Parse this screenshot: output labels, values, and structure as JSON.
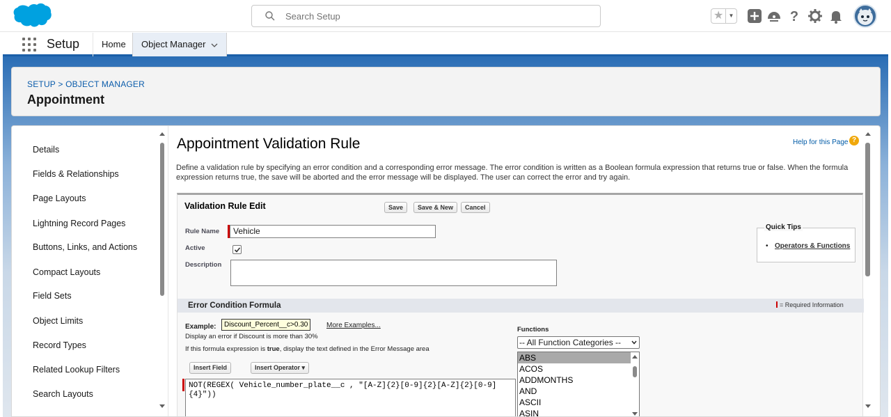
{
  "header": {
    "search_placeholder": "Search Setup",
    "brand_color": "#00A1E0"
  },
  "nav": {
    "app_name": "Setup",
    "tabs": [
      {
        "label": "Home"
      },
      {
        "label": "Object Manager"
      }
    ]
  },
  "page_header": {
    "breadcrumb": "SETUP > OBJECT MANAGER",
    "title": "Appointment"
  },
  "sidebar": {
    "items": [
      {
        "label": "Details"
      },
      {
        "label": "Fields & Relationships"
      },
      {
        "label": "Page Layouts"
      },
      {
        "label": "Lightning Record Pages"
      },
      {
        "label": "Buttons, Links, and Actions"
      },
      {
        "label": "Compact Layouts"
      },
      {
        "label": "Field Sets"
      },
      {
        "label": "Object Limits"
      },
      {
        "label": "Record Types"
      },
      {
        "label": "Related Lookup Filters"
      },
      {
        "label": "Search Layouts"
      }
    ]
  },
  "main": {
    "title": "Appointment Validation Rule",
    "help_link": "Help for this Page",
    "description": "Define a validation rule by specifying an error condition and a corresponding error message. The error condition is written as a Boolean formula expression that returns true or false. When the formula expression returns true, the save will be aborted and the error message will be displayed. The user can correct the error and try again."
  },
  "edit": {
    "section_title": "Validation Rule Edit",
    "save_label": "Save",
    "save_new_label": "Save & New",
    "cancel_label": "Cancel",
    "rule_name_label": "Rule Name",
    "rule_name_value": "Vehicle",
    "active_label": "Active",
    "active_checked": true,
    "description_label": "Description",
    "description_value": ""
  },
  "quick_tips": {
    "title": "Quick Tips",
    "link": "Operators & Functions"
  },
  "formula": {
    "section_title": "Error Condition Formula",
    "required_info": "= Required Information",
    "example_label": "Example:",
    "example_code": "Discount_Percent__c>0.30",
    "more_examples": "More Examples...",
    "hint_line1": "Display an error if Discount is more than 30%",
    "hint_line2_pre": "If this formula expression is ",
    "hint_line2_bold": "true",
    "hint_line2_post": ", display the text defined in the Error Message area",
    "insert_field": "Insert Field",
    "insert_operator": "Insert Operator",
    "value": "NOT(REGEX( Vehicle_number_plate__c , \"[A-Z]{2}[0-9]{2}[A-Z]{2}[0-9]{4}\"))"
  },
  "functions": {
    "label": "Functions",
    "category_selected": "-- All Function Categories --",
    "items": [
      "ABS",
      "ACOS",
      "ADDMONTHS",
      "AND",
      "ASCII",
      "ASIN"
    ],
    "selected_index": 0
  }
}
